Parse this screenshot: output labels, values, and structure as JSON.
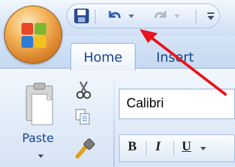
{
  "tabs": [
    {
      "label": "Home"
    },
    {
      "label": "Insert"
    }
  ],
  "clipboard": {
    "paste_label": "Paste"
  },
  "font": {
    "name": "Calibri",
    "bold_label": "B",
    "italic_label": "I",
    "underline_label": "U"
  },
  "colors": {
    "ribbon_blue": "#15428b",
    "arrow_red": "#e8131c"
  },
  "icons": {
    "office_button": "office-logo-icon",
    "save": "save-icon",
    "undo": "undo-icon",
    "redo": "redo-icon",
    "customize": "customize-qat-icon",
    "cut": "scissors-icon",
    "copy": "copy-icon",
    "format_painter": "paintbrush-icon",
    "paste": "clipboard-icon"
  }
}
